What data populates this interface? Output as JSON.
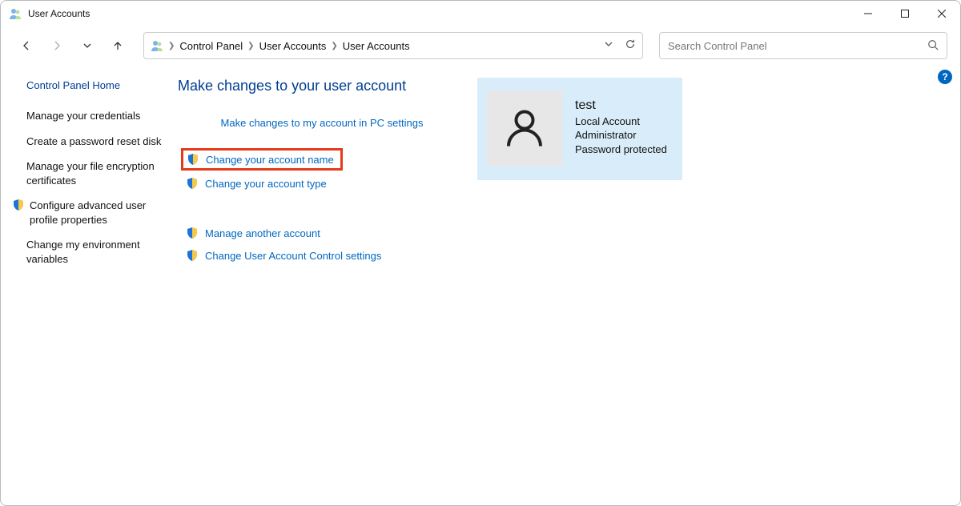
{
  "window": {
    "title": "User Accounts"
  },
  "breadcrumb": {
    "items": [
      "Control Panel",
      "User Accounts",
      "User Accounts"
    ]
  },
  "search": {
    "placeholder": "Search Control Panel"
  },
  "sidebar": {
    "home": "Control Panel Home",
    "links": {
      "credentials": "Manage your credentials",
      "reset_disk": "Create a password reset disk",
      "encryption": "Manage your file encryption certificates",
      "advanced": "Configure advanced user profile properties",
      "env_vars": "Change my environment variables"
    }
  },
  "main": {
    "heading": "Make changes to your user account",
    "links": {
      "pc_settings": "Make changes to my account in PC settings",
      "change_name": "Change your account name",
      "change_type": "Change your account type",
      "manage_another": "Manage another account",
      "uac": "Change User Account Control settings"
    }
  },
  "account": {
    "name": "test",
    "type": "Local Account",
    "role": "Administrator",
    "protection": "Password protected"
  }
}
